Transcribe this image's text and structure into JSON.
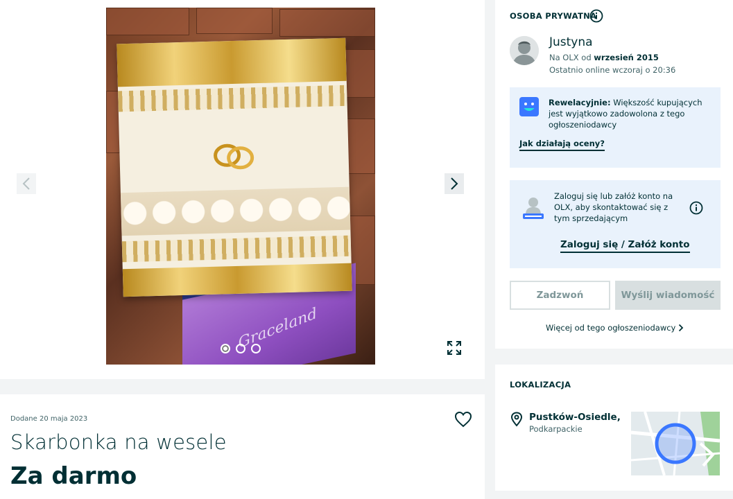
{
  "gallery": {
    "photo_brand_text": "Graceland",
    "dots_count": 3,
    "active_dot": 1
  },
  "ad": {
    "added": "Dodane 20 maja 2023",
    "title": "Skarbonka na wesele",
    "price": "Za darmo"
  },
  "seller": {
    "section_label": "OSOBA PRYWATNA",
    "name": "Justyna",
    "since_prefix": "Na OLX od ",
    "since_value": "wrzesień 2015",
    "last_online": "Ostatnio online wczoraj o 20:36",
    "rating": {
      "headline": "Rewelacyjnie:",
      "text": " Większość kupujących jest wyjątkowo zadowolona z tego ogłoszeniodawcy",
      "link": "Jak działają oceny?"
    },
    "login": {
      "text": "Zaloguj się lub załóż konto na OLX, aby skontaktować się z tym sprzedającym",
      "link": "Zaloguj się / Załóż konto"
    },
    "call_button": "Zadzwoń",
    "message_button": "Wyślij wiadomość",
    "more_ads": "Więcej od tego ogłoszeniodawcy"
  },
  "location": {
    "section_label": "LOKALIZACJA",
    "city": "Pustków-Osiedle,",
    "region": "Podkarpackie"
  },
  "colors": {
    "text_primary": "#002f34",
    "info_box": "#e9f2fc",
    "accent_blue": "#3a77ff",
    "button_disabled": "#d8dfe0"
  }
}
